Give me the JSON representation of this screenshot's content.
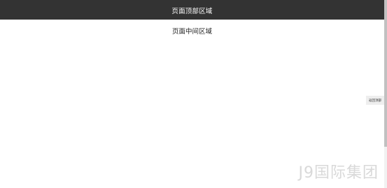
{
  "header": {
    "title": "页面顶部区域"
  },
  "main": {
    "text": "页面中间区域"
  },
  "back_to_top": {
    "label": "返回顶部"
  },
  "watermark": {
    "text": "J9国际集团"
  }
}
